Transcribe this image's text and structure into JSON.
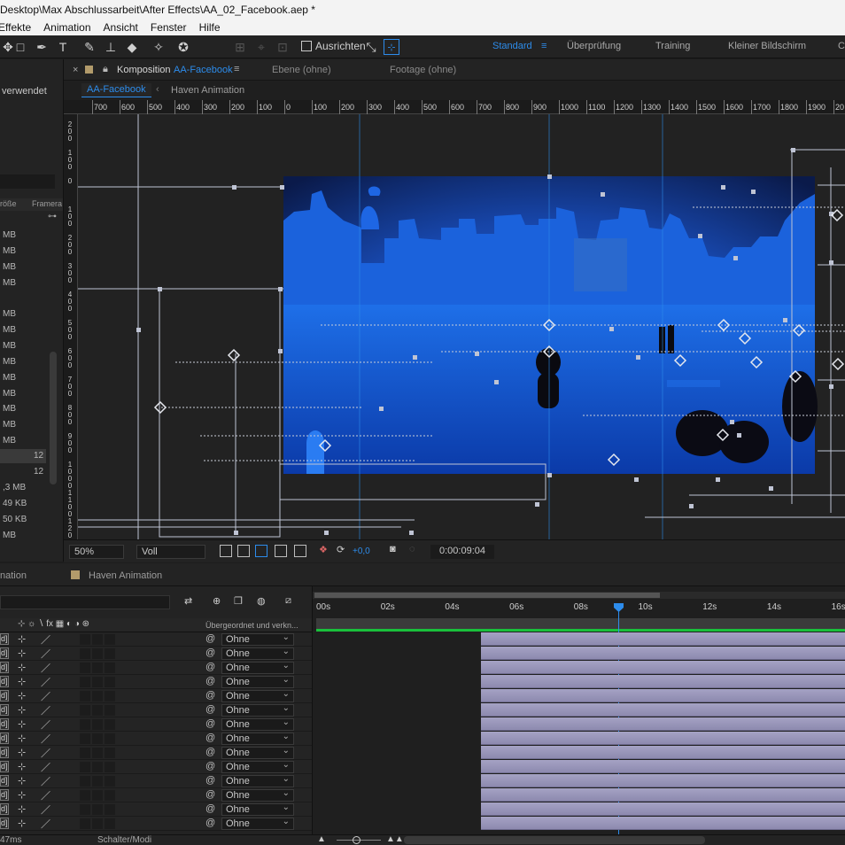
{
  "app": {
    "title": "Desktop\\Max Abschlussarbeit\\After Effects\\AA_02_Facebook.aep *",
    "menu": [
      "Effekte",
      "Animation",
      "Ansicht",
      "Fenster",
      "Hilfe"
    ]
  },
  "toolbar": {
    "snap_label": "Ausrichten",
    "workspaces": [
      "Standard",
      "Überprüfung",
      "Training",
      "Kleiner Bildschirm",
      "C"
    ]
  },
  "project": {
    "used_label": "verwendet",
    "header_cols": [
      "röße",
      "Framera"
    ],
    "sizes": [
      "MB",
      "MB",
      "MB",
      "MB",
      "MB",
      "MB",
      "MB",
      "MB",
      "MB",
      "MB",
      "MB",
      "MB",
      "MB",
      "12",
      "12",
      ",3 MB",
      "49 KB",
      "50 KB",
      "MB"
    ]
  },
  "composition": {
    "tab_label": "Komposition",
    "tab_name": "AA-Facebook",
    "layer_tab": "Ebene (ohne)",
    "footage_tab": "Footage (ohne)",
    "nav_active": "AA-Facebook",
    "nav_other": "Haven Animation",
    "ruler_h": [
      "700",
      "600",
      "500",
      "400",
      "300",
      "200",
      "100",
      "0",
      "100",
      "200",
      "300",
      "400",
      "500",
      "600",
      "700",
      "800",
      "900",
      "1000",
      "1100",
      "1200",
      "1300",
      "1400",
      "1500",
      "1600",
      "1700",
      "1800",
      "1900",
      "20"
    ],
    "ruler_v": [
      "2 0 0",
      "1 0 0",
      "0",
      "1 0 0",
      "2 0 0",
      "3 0 0",
      "4 0 0",
      "5 0 0",
      "6 0 0",
      "7 0 0",
      "8 0 0",
      "9 0 0",
      "1 0 0 0",
      "1 1 0 0",
      "1 2 0 0"
    ]
  },
  "viewer_bar": {
    "zoom": "50%",
    "resolution": "Voll",
    "exposure": "+0,0",
    "timecode": "0:00:09:04"
  },
  "timeline": {
    "tab_left": "nation",
    "tab_right": "Haven Animation",
    "parent_header": "Übergeordnet und verkn...",
    "time_labels": [
      "00s",
      "02s",
      "04s",
      "06s",
      "08s",
      "10s",
      "12s",
      "14s",
      "16s"
    ],
    "row_labels": [
      "d]",
      "d]",
      "d]",
      "d]",
      "d]",
      "d]",
      "d]",
      "d]",
      "d]",
      "d]",
      "d]",
      "d]",
      "d]",
      "d]"
    ],
    "parent_values": [
      "Ohne",
      "Ohne",
      "Ohne",
      "Ohne",
      "Ohne",
      "Ohne",
      "Ohne",
      "Ohne",
      "Ohne",
      "Ohne",
      "Ohne",
      "Ohne",
      "Ohne",
      "Ohne"
    ]
  },
  "status": {
    "render_time": "47ms",
    "mode": "Schalter/Modi"
  },
  "colors": {
    "accent": "#2d8ceb",
    "panel": "#232323",
    "layer_bar": "#9c99bf",
    "work_area_green": "#19c03b"
  }
}
